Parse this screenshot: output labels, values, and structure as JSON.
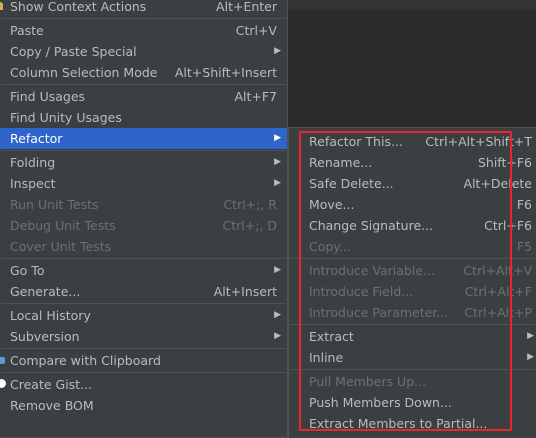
{
  "main_menu": {
    "items": [
      {
        "label": "Show Context Actions",
        "shortcut": "Alt+Enter"
      },
      {
        "label": "Paste",
        "shortcut": "Ctrl+V"
      },
      {
        "label": "Copy / Paste Special",
        "shortcut": ""
      },
      {
        "label": "Column Selection Mode",
        "shortcut": "Alt+Shift+Insert"
      },
      {
        "label": "Find Usages",
        "shortcut": "Alt+F7"
      },
      {
        "label": "Find Unity Usages",
        "shortcut": ""
      },
      {
        "label": "Refactor",
        "shortcut": ""
      },
      {
        "label": "Folding",
        "shortcut": ""
      },
      {
        "label": "Inspect",
        "shortcut": ""
      },
      {
        "label": "Run Unit Tests",
        "shortcut": "Ctrl+;, R"
      },
      {
        "label": "Debug Unit Tests",
        "shortcut": "Ctrl+;, D"
      },
      {
        "label": "Cover Unit Tests",
        "shortcut": ""
      },
      {
        "label": "Go To",
        "shortcut": ""
      },
      {
        "label": "Generate...",
        "shortcut": "Alt+Insert"
      },
      {
        "label": "Local History",
        "shortcut": ""
      },
      {
        "label": "Subversion",
        "shortcut": ""
      },
      {
        "label": "Compare with Clipboard",
        "shortcut": ""
      },
      {
        "label": "Create Gist...",
        "shortcut": ""
      },
      {
        "label": "Remove BOM",
        "shortcut": ""
      }
    ]
  },
  "refactor_menu": {
    "items": [
      {
        "label": "Refactor This...",
        "shortcut": "Ctrl+Alt+Shift+T"
      },
      {
        "label": "Rename...",
        "shortcut": "Shift+F6"
      },
      {
        "label": "Safe Delete...",
        "shortcut": "Alt+Delete"
      },
      {
        "label": "Move...",
        "shortcut": "F6"
      },
      {
        "label": "Change Signature...",
        "shortcut": "Ctrl+F6"
      },
      {
        "label": "Copy...",
        "shortcut": "F5"
      },
      {
        "label": "Introduce Variable...",
        "shortcut": "Ctrl+Alt+V"
      },
      {
        "label": "Introduce Field...",
        "shortcut": "Ctrl+Alt+F"
      },
      {
        "label": "Introduce Parameter...",
        "shortcut": "Ctrl+Alt+P"
      },
      {
        "label": "Extract",
        "shortcut": ""
      },
      {
        "label": "Inline",
        "shortcut": ""
      },
      {
        "label": "Pull Members Up...",
        "shortcut": ""
      },
      {
        "label": "Push Members Down...",
        "shortcut": ""
      },
      {
        "label": "Extract Members to Partial...",
        "shortcut": ""
      }
    ]
  },
  "colors": {
    "menu_bg": "#3c3f41",
    "selection": "#2f65ca",
    "highlight_box": "#e8262b",
    "text": "#bbbbbb",
    "disabled_text": "#6f6f6f"
  },
  "icons": [
    "lightbulb-icon",
    "compare-icon",
    "gist-icon"
  ]
}
